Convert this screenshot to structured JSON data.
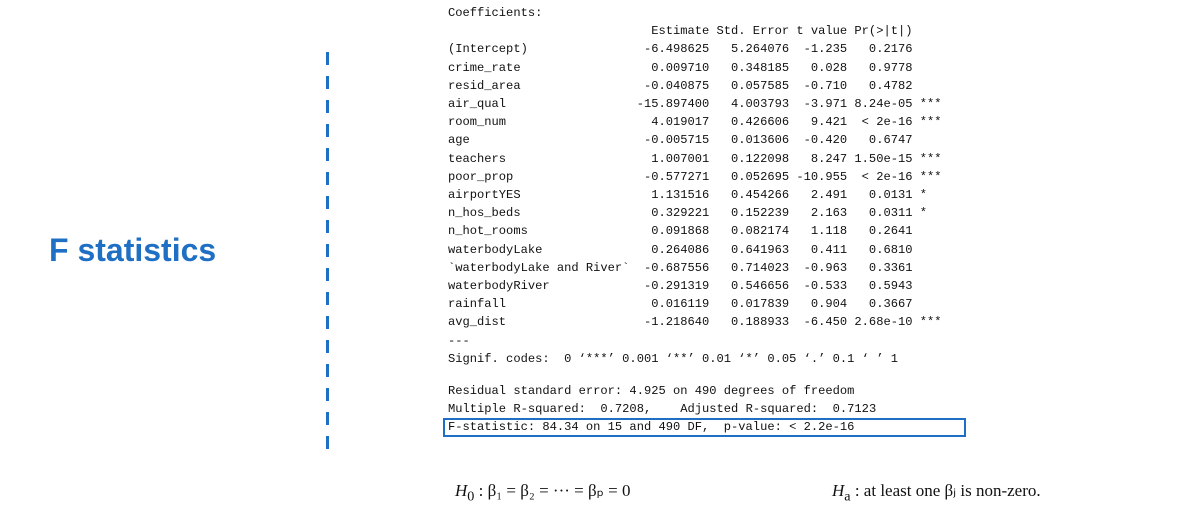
{
  "section_title": "F statistics",
  "coefficients_output": "Coefficients:\n                            Estimate Std. Error t value Pr(>|t|)    \n(Intercept)                -6.498625   5.264076  -1.235   0.2176    \ncrime_rate                  0.009710   0.348185   0.028   0.9778    \nresid_area                 -0.040875   0.057585  -0.710   0.4782    \nair_qual                  -15.897400   4.003793  -3.971 8.24e-05 ***\nroom_num                    4.019017   0.426606   9.421  < 2e-16 ***\nage                        -0.005715   0.013606  -0.420   0.6747    \nteachers                    1.007001   0.122098   8.247 1.50e-15 ***\npoor_prop                  -0.577271   0.052695 -10.955  < 2e-16 ***\nairportYES                  1.131516   0.454266   2.491   0.0131 *  \nn_hos_beds                  0.329221   0.152239   2.163   0.0311 *  \nn_hot_rooms                 0.091868   0.082174   1.118   0.2641    \nwaterbodyLake               0.264086   0.641963   0.411   0.6810    \n`waterbodyLake and River`  -0.687556   0.714023  -0.963   0.3361    \nwaterbodyRiver             -0.291319   0.546656  -0.533   0.5943    \nrainfall                    0.016119   0.017839   0.904   0.3667    \navg_dist                   -1.218640   0.188933  -6.450 2.68e-10 ***\n---\nSignif. codes:  0 ‘***’ 0.001 ‘**’ 0.01 ‘*’ 0.05 ‘.’ 0.1 ‘ ’ 1",
  "model_summary": "Residual standard error: 4.925 on 490 degrees of freedom\nMultiple R-squared:  0.7208,\tAdjusted R-squared:  0.7123 \nF-statistic: 84.34 on 15 and 490 DF,  p-value: < 2.2e-16",
  "h0_label": "H",
  "h0_sub": "0",
  "h0_text": " : β₁ = β₂ = ··· = βₚ = 0",
  "ha_label": "H",
  "ha_sub": "a",
  "ha_text": " :  at least one βⱼ is non-zero.",
  "colors": {
    "accent": "#1f6fc4",
    "text": "#111111"
  }
}
